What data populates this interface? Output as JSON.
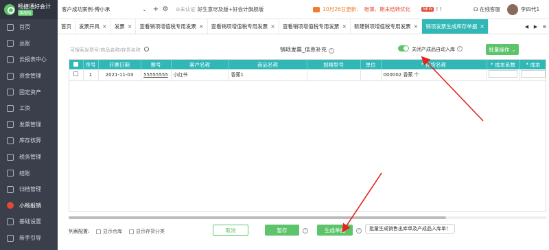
{
  "app": {
    "logo_text": "畅捷通好会计",
    "logo_tag": "旗舰版"
  },
  "sidebar": {
    "items": [
      {
        "label": "首页",
        "icon": "home-icon"
      },
      {
        "label": "总账",
        "icon": "ledger-icon"
      },
      {
        "label": "云报表中心",
        "icon": "report-icon"
      },
      {
        "label": "资金管理",
        "icon": "fund-icon"
      },
      {
        "label": "固定资产",
        "icon": "asset-icon"
      },
      {
        "label": "工资",
        "icon": "salary-icon"
      },
      {
        "label": "发票管理",
        "icon": "invoice-icon"
      },
      {
        "label": "库存核算",
        "icon": "inventory-icon"
      },
      {
        "label": "税务管理",
        "icon": "tax-icon"
      },
      {
        "label": "结账",
        "icon": "close-account-icon"
      },
      {
        "label": "归档管理",
        "icon": "archive-icon"
      },
      {
        "label": "小畅报销",
        "icon": "expense-icon",
        "active": true
      },
      {
        "label": "基础设置",
        "icon": "settings-icon"
      },
      {
        "label": "新手引导",
        "icon": "guide-icon"
      }
    ]
  },
  "header": {
    "company": "客户成功案例-傅小承",
    "unverified": "未认证",
    "slogan": "好生意尽及版+好会计旗舰版",
    "notice_prefix": "10月26日更新：",
    "notice_highlight": "账簿、期末结转优化",
    "new_badge": "NEW",
    "service": "在线客服",
    "username": "李四代1"
  },
  "tabs": [
    {
      "label": "首页",
      "closable": false
    },
    {
      "label": "发票开具",
      "closable": true
    },
    {
      "label": "发票",
      "closable": true
    },
    {
      "label": "查看销项增值税专用发票",
      "closable": true
    },
    {
      "label": "查看销项增值税专用发票",
      "closable": true
    },
    {
      "label": "查看销项增值税专用发票",
      "closable": true
    },
    {
      "label": "新建销项增值税专用发票",
      "closable": true
    },
    {
      "label": "销项发票生成库存单据",
      "closable": true,
      "active": true
    }
  ],
  "toolbar": {
    "search_placeholder": "可搜索发票号/商品名称/存货名称",
    "title": "销项发票_信息补充",
    "toggle_label": "关闭产成品自动入库",
    "toggle_on": true,
    "batch_button": "批量操作"
  },
  "table": {
    "columns": [
      "",
      "序号",
      "开票日期",
      "票号",
      "客户名称",
      "商品名称",
      "规格型号",
      "单位",
      "* 存货名称",
      "* 成本系数",
      "* 成本"
    ],
    "rows": [
      {
        "seq": "1",
        "date": "2021-11-03",
        "invoice_no": "55555555",
        "customer": "小红书",
        "product": "香蕉1",
        "spec": "",
        "unit": "",
        "inventory": "000002 香蕉 个",
        "cost_factor": "",
        "cost": ""
      }
    ]
  },
  "footer": {
    "column_config": "列表配置:",
    "show_warehouse": "显示仓库",
    "show_inventory_category": "显示存货分类",
    "cancel": "取消",
    "save": "暂存",
    "generate": "生成单据",
    "tooltip": "批量生成销售出库单及产成品入库单！"
  },
  "colors": {
    "accent": "#30b7b6",
    "button_green": "#5ec46c",
    "sidebar_bg": "#3a3f4b",
    "notice_orange": "#f07c2c",
    "annotation_red": "#e2261c"
  }
}
